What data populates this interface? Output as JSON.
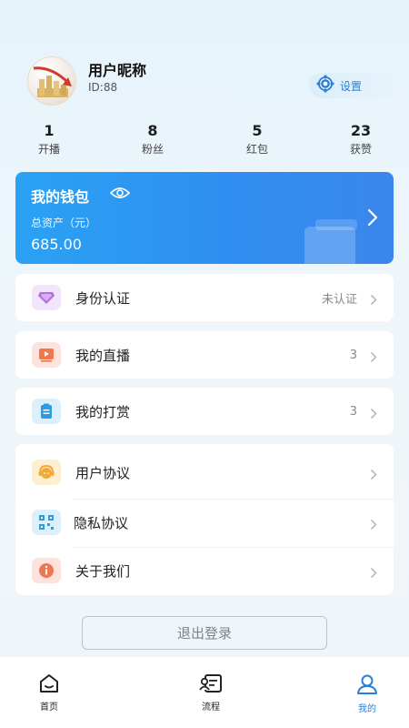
{
  "profile": {
    "nickname": "用户昵称",
    "id_text": "ID:88",
    "settings_label": "设置"
  },
  "stats": [
    {
      "value": "1",
      "label": "开播"
    },
    {
      "value": "8",
      "label": "粉丝"
    },
    {
      "value": "5",
      "label": "红包"
    },
    {
      "value": "23",
      "label": "获赞"
    }
  ],
  "wallet": {
    "title": "我的钱包",
    "subtitle": "总资产（元）",
    "amount": "685.00"
  },
  "menu": {
    "identity": {
      "label": "身份认证",
      "value": "未认证"
    },
    "live": {
      "label": "我的直播",
      "value": "3"
    },
    "reward": {
      "label": "我的打赏",
      "value": "3"
    },
    "agreement": {
      "label": "用户协议"
    },
    "privacy": {
      "label": "隐私协议"
    },
    "about": {
      "label": "关于我们"
    }
  },
  "logout_label": "退出登录",
  "tabs": [
    {
      "label": "首页"
    },
    {
      "label": "流程"
    },
    {
      "label": "我的"
    }
  ],
  "colors": {
    "accent": "#2b7fd6",
    "wallet_start": "#2aa2f4",
    "wallet_end": "#3a86ec"
  }
}
